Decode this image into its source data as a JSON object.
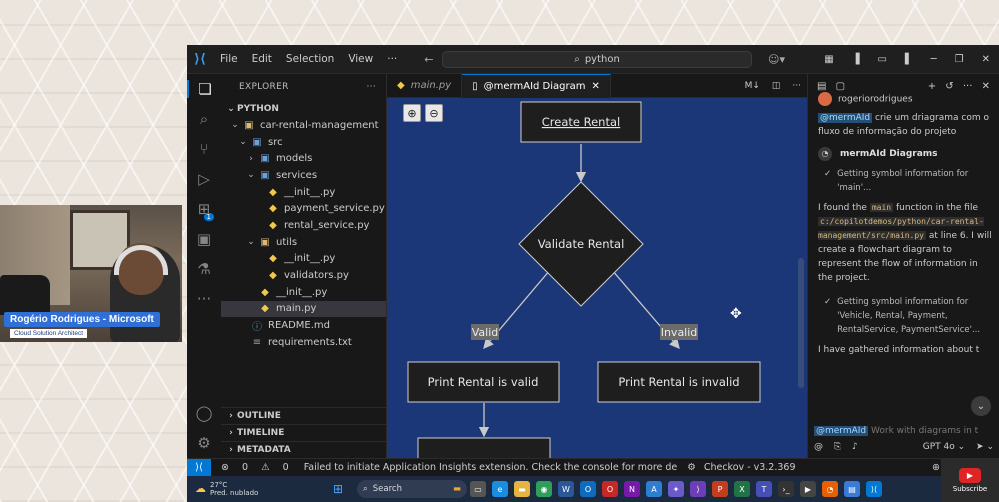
{
  "webcam": {
    "name": "Rogério Rodrigues - Microsoft",
    "role": "Cloud Solution Architect"
  },
  "titlebar": {
    "menu": [
      "File",
      "Edit",
      "Selection",
      "View",
      "···"
    ],
    "search": "python"
  },
  "activity_badge": "1",
  "explorer": {
    "title": "EXPLORER",
    "more": "···",
    "section": "PYTHON",
    "tree": [
      {
        "label": "car-rental-management",
        "depth": 1,
        "kind": "folder",
        "open": true
      },
      {
        "label": "src",
        "depth": 2,
        "kind": "folder-blue",
        "open": true
      },
      {
        "label": "models",
        "depth": 3,
        "kind": "folder-blue",
        "open": false
      },
      {
        "label": "services",
        "depth": 3,
        "kind": "folder-blue",
        "open": true
      },
      {
        "label": "__init__.py",
        "depth": 4,
        "kind": "py"
      },
      {
        "label": "payment_service.py",
        "depth": 4,
        "kind": "py"
      },
      {
        "label": "rental_service.py",
        "depth": 4,
        "kind": "py"
      },
      {
        "label": "utils",
        "depth": 3,
        "kind": "folder",
        "open": true
      },
      {
        "label": "__init__.py",
        "depth": 4,
        "kind": "py"
      },
      {
        "label": "validators.py",
        "depth": 4,
        "kind": "py"
      },
      {
        "label": "__init__.py",
        "depth": 3,
        "kind": "py"
      },
      {
        "label": "main.py",
        "depth": 3,
        "kind": "py",
        "selected": true
      },
      {
        "label": "README.md",
        "depth": 2,
        "kind": "md"
      },
      {
        "label": "requirements.txt",
        "depth": 2,
        "kind": "txt"
      }
    ],
    "bottom_sections": [
      "OUTLINE",
      "TIMELINE",
      "METADATA"
    ]
  },
  "tabs": [
    {
      "label": "main.py",
      "active": false
    },
    {
      "label": "@mermAId Diagram",
      "active": true
    }
  ],
  "tab_badge": "M↓",
  "diagram": {
    "nodes": {
      "create": "Create Rental",
      "validate": "Validate Rental",
      "valid_out": "Print Rental is valid",
      "invalid_out": "Print Rental is invalid"
    },
    "edges": {
      "valid": "Valid",
      "invalid": "Invalid"
    },
    "colors": {
      "background": "#1b3778",
      "node_fill": "#1e1e1e",
      "node_stroke": "#cfcfcf",
      "edge": "#c9c9c9",
      "edge_label_bg": "#6b6b6b"
    }
  },
  "chat": {
    "user_name": "rogeriorodrigues",
    "user_mention": "@mermAId",
    "user_message": "crie um driagrama com o fluxo de informação do projeto",
    "bot_name": "mermAId Diagrams",
    "step1": "Getting symbol information for 'main'...",
    "resp_part1": "I found the",
    "resp_code1": "main",
    "resp_part2": "function in the file",
    "resp_code2": "c:/copilotdemos/python/car-rental-management/src/main.py",
    "resp_part3": "at line 6. I will create a flowchart diagram to represent the flow of information in the project.",
    "step2": "Getting symbol information for 'Vehicle, Rental, Payment, RentalService, PaymentService'...",
    "resp_last": "I have gathered information about t",
    "input_mention": "@mermAId",
    "input_placeholder": "Work with diagrams in t",
    "model": "GPT 4o"
  },
  "statusbar": {
    "errors": "0",
    "warnings": "0",
    "message": "Failed to initiate Application Insights extension. Check the console for more de",
    "checkov": "Checkov - v3.2.369"
  },
  "taskbar": {
    "temp": "27°C",
    "weather": "Pred. nublado",
    "search": "Search"
  },
  "subscribe": "Subscribe"
}
